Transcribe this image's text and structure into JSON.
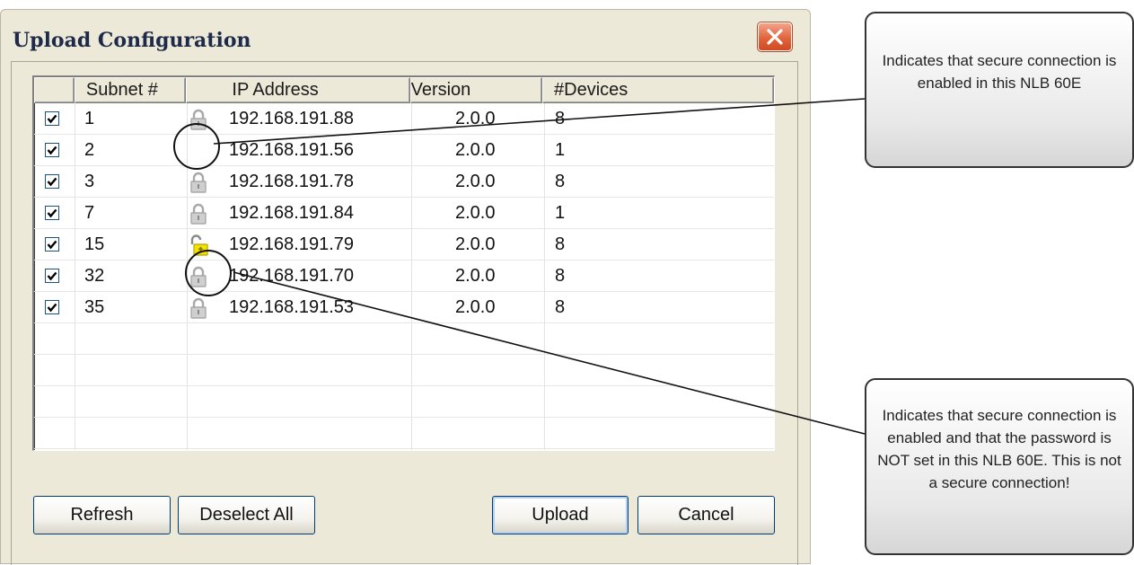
{
  "dialog": {
    "title": "Upload Configuration",
    "close_icon": "close-icon"
  },
  "table": {
    "columns": [
      "",
      "Subnet #",
      "IP Address",
      "Version",
      "#Devices"
    ],
    "rows": [
      {
        "checked": true,
        "subnet": "1",
        "ip": "192.168.191.88",
        "version": "2.0.0",
        "devices": "8",
        "lock": "locked-gray"
      },
      {
        "checked": true,
        "subnet": "2",
        "ip": "192.168.191.56",
        "version": "2.0.0",
        "devices": "1",
        "lock": "none"
      },
      {
        "checked": true,
        "subnet": "3",
        "ip": "192.168.191.78",
        "version": "2.0.0",
        "devices": "8",
        "lock": "locked-gray"
      },
      {
        "checked": true,
        "subnet": "7",
        "ip": "192.168.191.84",
        "version": "2.0.0",
        "devices": "1",
        "lock": "locked-gray"
      },
      {
        "checked": true,
        "subnet": "15",
        "ip": "192.168.191.79",
        "version": "2.0.0",
        "devices": "8",
        "lock": "unlocked-yellow"
      },
      {
        "checked": true,
        "subnet": "32",
        "ip": "192.168.191.70",
        "version": "2.0.0",
        "devices": "8",
        "lock": "locked-gray"
      },
      {
        "checked": true,
        "subnet": "35",
        "ip": "192.168.191.53",
        "version": "2.0.0",
        "devices": "8",
        "lock": "locked-gray"
      }
    ]
  },
  "buttons": {
    "refresh": "Refresh",
    "deselect_all": "Deselect All",
    "upload": "Upload",
    "cancel": "Cancel"
  },
  "annotations": {
    "secure_enabled": "Indicates that secure connection is enabled in this NLB 60E",
    "secure_no_password": "Indicates that secure connection is enabled and that the password is NOT set in this NLB 60E. This is not a secure connection!"
  },
  "colors": {
    "dialog_bg": "#ece9d8",
    "close_button": "#e2643c",
    "lock_gray": "#a8a8a8",
    "lock_yellow": "#f4e200"
  }
}
